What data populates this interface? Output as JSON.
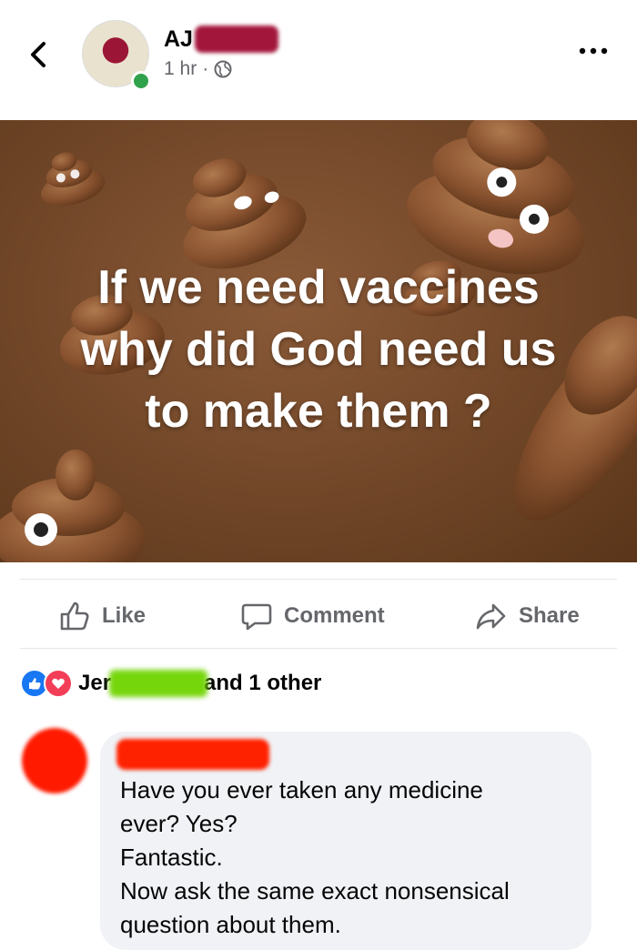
{
  "header": {
    "author_visible": "AJ",
    "timestamp": "1 hr",
    "separator": "·",
    "privacy_icon": "globe-icon",
    "back_icon": "chevron-left-icon",
    "more_icon": "more-horizontal-icon"
  },
  "post": {
    "lines": [
      "If we need vaccines",
      "why did God need us",
      "to make them ?"
    ]
  },
  "actions": {
    "like": "Like",
    "comment": "Comment",
    "share": "Share"
  },
  "reactions": {
    "name_prefix": "Jer",
    "suffix": "and 1 other"
  },
  "comment": {
    "lines": [
      "Have you ever taken any medicine",
      "ever? Yes?",
      "Fantastic.",
      "Now ask the same exact nonsensical",
      "question about them."
    ]
  },
  "colors": {
    "accent_like": "#1877f2",
    "love": "#f33e58",
    "online": "#31a24c",
    "muted_text": "#65676b",
    "bubble": "#f0f2f5"
  }
}
